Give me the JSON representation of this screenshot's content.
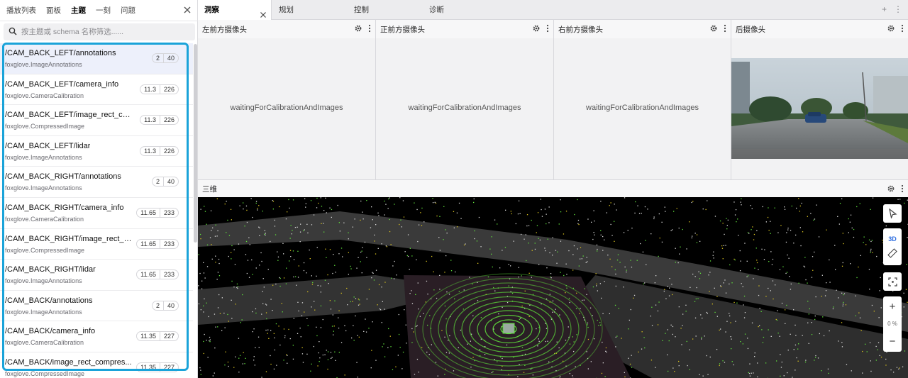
{
  "sidebar": {
    "tabs": [
      {
        "label": "播放列表"
      },
      {
        "label": "面板"
      },
      {
        "label": "主题"
      },
      {
        "label": "一刻"
      },
      {
        "label": "问题"
      }
    ],
    "active_tab": "主题",
    "search_placeholder": "按主题或 schema 名称筛选......",
    "topics": [
      {
        "name": "/CAM_BACK_LEFT/annotations",
        "schema": "foxglove.ImageAnnotations",
        "hz": "2",
        "count": "40"
      },
      {
        "name": "/CAM_BACK_LEFT/camera_info",
        "schema": "foxglove.CameraCalibration",
        "hz": "11.3",
        "count": "226"
      },
      {
        "name": "/CAM_BACK_LEFT/image_rect_com...",
        "schema": "foxglove.CompressedImage",
        "hz": "11.3",
        "count": "226"
      },
      {
        "name": "/CAM_BACK_LEFT/lidar",
        "schema": "foxglove.ImageAnnotations",
        "hz": "11.3",
        "count": "226"
      },
      {
        "name": "/CAM_BACK_RIGHT/annotations",
        "schema": "foxglove.ImageAnnotations",
        "hz": "2",
        "count": "40"
      },
      {
        "name": "/CAM_BACK_RIGHT/camera_info",
        "schema": "foxglove.CameraCalibration",
        "hz": "11.65",
        "count": "233"
      },
      {
        "name": "/CAM_BACK_RIGHT/image_rect_c...",
        "schema": "foxglove.CompressedImage",
        "hz": "11.65",
        "count": "233"
      },
      {
        "name": "/CAM_BACK_RIGHT/lidar",
        "schema": "foxglove.ImageAnnotations",
        "hz": "11.65",
        "count": "233"
      },
      {
        "name": "/CAM_BACK/annotations",
        "schema": "foxglove.ImageAnnotations",
        "hz": "2",
        "count": "40"
      },
      {
        "name": "/CAM_BACK/camera_info",
        "schema": "foxglove.CameraCalibration",
        "hz": "11.35",
        "count": "227"
      },
      {
        "name": "/CAM_BACK/image_rect_compres...",
        "schema": "foxglove.CompressedImage",
        "hz": "11.35",
        "count": "227"
      }
    ]
  },
  "workspace": {
    "tabs": [
      {
        "label": "洞察"
      },
      {
        "label": "规划"
      },
      {
        "label": "控制"
      },
      {
        "label": "诊断"
      }
    ],
    "add_icon": "plus-icon",
    "more_icon": "more-vertical-icon"
  },
  "panels": {
    "cam_left": {
      "title": "左前方摄像头",
      "message": "waitingForCalibrationAndImages"
    },
    "cam_front": {
      "title": "正前方摄像头",
      "message": "waitingForCalibrationAndImages"
    },
    "cam_right": {
      "title": "右前方摄像头",
      "message": "waitingForCalibrationAndImages"
    },
    "cam_back": {
      "title": "后摄像头"
    },
    "view3d": {
      "title": "三维",
      "mode_label": "3D",
      "zoom_label": "0 %"
    }
  },
  "colors": {
    "highlight": "#1aa3d9",
    "accent": "#2f6fe0",
    "lidar_green": "#5fe13c"
  }
}
